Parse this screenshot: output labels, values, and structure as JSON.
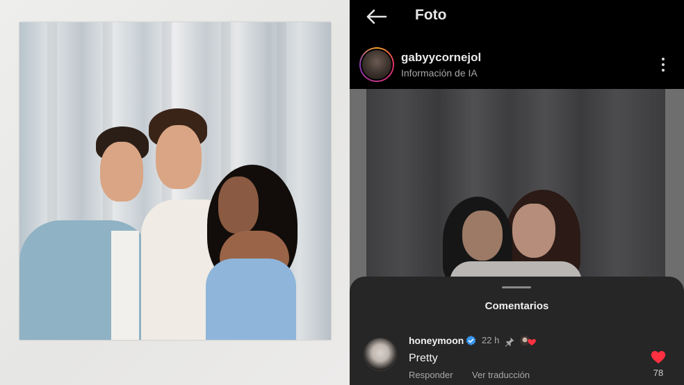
{
  "header": {
    "title": "Foto",
    "back_icon": "arrow-left-icon"
  },
  "post": {
    "username": "gabyycornejol",
    "subtitle": "Información de IA",
    "more_icon": "more-vertical-icon"
  },
  "comments_sheet": {
    "title": "Comentarios",
    "comments": [
      {
        "username": "honeymoon",
        "verified": true,
        "time": "22 h",
        "pinned": true,
        "liked_by_author": true,
        "text": "Pretty",
        "reply_label": "Responder",
        "translate_label": "Ver traducción",
        "likes": "78"
      }
    ]
  },
  "colors": {
    "accent_red": "#ff3040",
    "verified_blue": "#3897f0",
    "sheet_bg": "#262626",
    "topbar_bg": "#000000"
  }
}
